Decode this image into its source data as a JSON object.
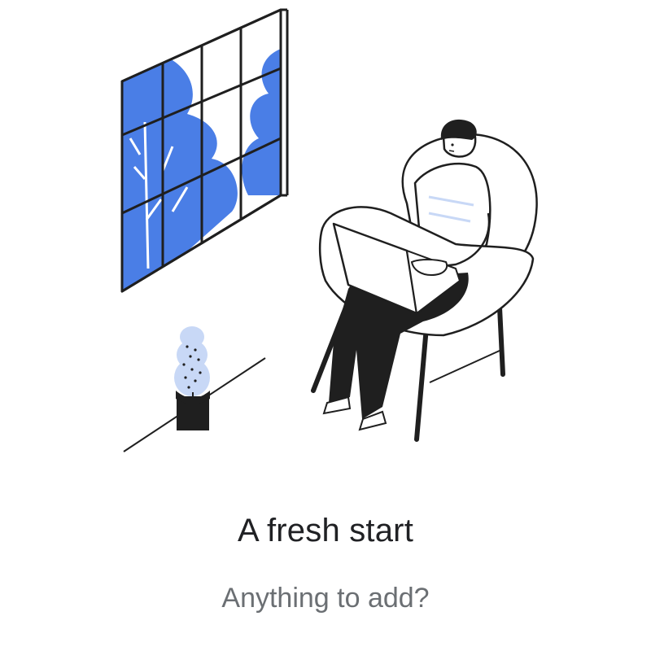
{
  "empty_state": {
    "illustration_icon": "person-relaxing-with-laptop-illustration",
    "title": "A fresh start",
    "subtitle": "Anything to add?"
  },
  "colors": {
    "accent_blue": "#4a7ee6",
    "light_blue": "#c8d8f6",
    "ink": "#1f1f1f",
    "title_text": "#202124",
    "subtitle_text": "#6b6f73"
  }
}
